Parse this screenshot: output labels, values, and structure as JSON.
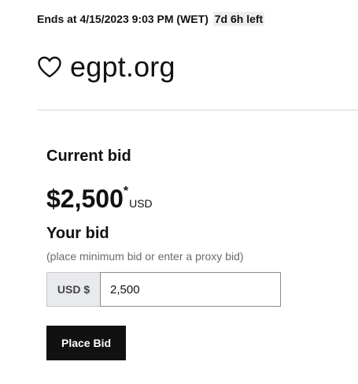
{
  "auction": {
    "ends_text": "Ends at 4/15/2023 9:03 PM (WET)",
    "time_left": "7d 6h left"
  },
  "domain": {
    "name": "egpt.org",
    "favorite_icon": "heart-outline-icon"
  },
  "bid": {
    "current_label": "Current bid",
    "current_amount": "$2,500",
    "asterisk": "*",
    "currency": "USD",
    "your_bid_label": "Your bid",
    "hint": "(place minimum bid or enter a proxy bid)",
    "input_prefix": "USD $",
    "input_value": "2,500",
    "place_bid_label": "Place Bid"
  },
  "colors": {
    "button_bg": "#111111",
    "prefix_bg": "#e8eaed",
    "divider": "#d6d6d6"
  }
}
